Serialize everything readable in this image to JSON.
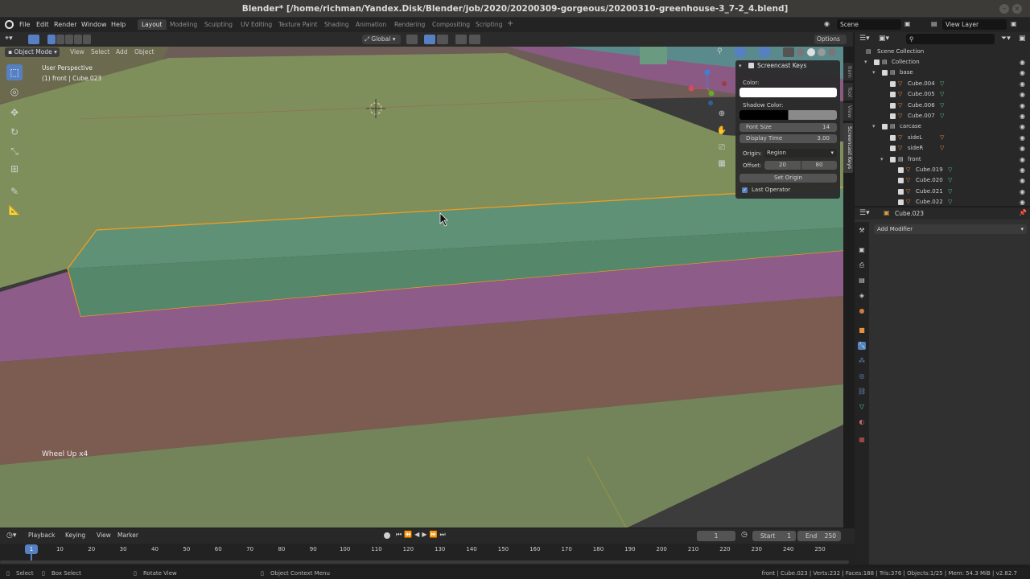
{
  "window": {
    "title": "Blender* [/home/richman/Yandex.Disk/Blender/job/2020/20200309-gorgeous/20200310-greenhouse-3_7-2_4.blend]"
  },
  "menu": [
    "File",
    "Edit",
    "Render",
    "Window",
    "Help"
  ],
  "workspaces": [
    {
      "label": "Layout",
      "active": true
    },
    {
      "label": "Modeling"
    },
    {
      "label": "Sculpting"
    },
    {
      "label": "UV Editing"
    },
    {
      "label": "Texture Paint"
    },
    {
      "label": "Shading"
    },
    {
      "label": "Animation"
    },
    {
      "label": "Rendering"
    },
    {
      "label": "Compositing"
    },
    {
      "label": "Scripting"
    }
  ],
  "add_workspace": "+",
  "scene": {
    "name": "Scene",
    "view_layer": "View Layer"
  },
  "viewport_header": {
    "transform_orientation": "Global",
    "options": "Options",
    "mode": "Object Mode",
    "menus": [
      "View",
      "Select",
      "Add",
      "Object"
    ]
  },
  "viewport": {
    "perspective": "User Perspective",
    "object_info": "(1) front | Cube.023",
    "operator_overlay": "Wheel Up x4",
    "colors": {
      "green": "#7f8f5b",
      "teal": "#5c8f72",
      "purple": "#8d5c88",
      "brown": "#7c5c51",
      "selection": "#f39c1d"
    }
  },
  "screencast_panel": {
    "title": "Screencast Keys",
    "color_label": "Color:",
    "shadow_label": "Shadow Color:",
    "font_size_label": "Font Size",
    "font_size": "14",
    "display_time_label": "Display Time",
    "display_time": "3.00",
    "origin_label": "Origin:",
    "origin_value": "Region",
    "offset_label": "Offset:",
    "offset_x": "20",
    "offset_y": "80",
    "set_origin": "Set Origin",
    "last_operator": "Last Operator"
  },
  "sidebar_tabs": [
    "Item",
    "Tool",
    "View",
    "Screencast Keys"
  ],
  "outliner": {
    "root": "Scene Collection",
    "rows": [
      {
        "label": "Collection",
        "indent": 1,
        "kind": "collection"
      },
      {
        "label": "base",
        "indent": 2,
        "kind": "collection"
      },
      {
        "label": "Cube.004",
        "indent": 3,
        "kind": "mesh"
      },
      {
        "label": "Cube.005",
        "indent": 3,
        "kind": "mesh"
      },
      {
        "label": "Cube.006",
        "indent": 3,
        "kind": "mesh"
      },
      {
        "label": "Cube.007",
        "indent": 3,
        "kind": "mesh"
      },
      {
        "label": "carcase",
        "indent": 2,
        "kind": "collection"
      },
      {
        "label": "sideL",
        "indent": 3,
        "kind": "mesh-mod"
      },
      {
        "label": "sideR",
        "indent": 3,
        "kind": "mesh-mod"
      },
      {
        "label": "front",
        "indent": 3,
        "kind": "collection"
      },
      {
        "label": "Cube.019",
        "indent": 4,
        "kind": "mesh"
      },
      {
        "label": "Cube.020",
        "indent": 4,
        "kind": "mesh"
      },
      {
        "label": "Cube.021",
        "indent": 4,
        "kind": "mesh"
      },
      {
        "label": "Cube.022",
        "indent": 4,
        "kind": "mesh"
      }
    ]
  },
  "properties": {
    "object_name": "Cube.023",
    "add_modifier": "Add Modifier"
  },
  "timeline": {
    "menus": [
      "Playback",
      "Keying",
      "View",
      "Marker"
    ],
    "current_frame": "1",
    "start_label": "Start",
    "start": "1",
    "end_label": "End",
    "end": "250",
    "ticks": [
      "1",
      "10",
      "20",
      "30",
      "40",
      "50",
      "60",
      "70",
      "80",
      "90",
      "100",
      "110",
      "120",
      "130",
      "140",
      "150",
      "160",
      "170",
      "180",
      "190",
      "200",
      "210",
      "220",
      "230",
      "240",
      "250"
    ]
  },
  "statusbar": {
    "select": "Select",
    "box_select": "Box Select",
    "rotate_view": "Rotate View",
    "context_menu": "Object Context Menu",
    "stats": "front | Cube.023 | Verts:232 | Faces:188 | Tris:376 | Objects:1/25 | Mem: 54.3 MiB | v2.82.7"
  }
}
